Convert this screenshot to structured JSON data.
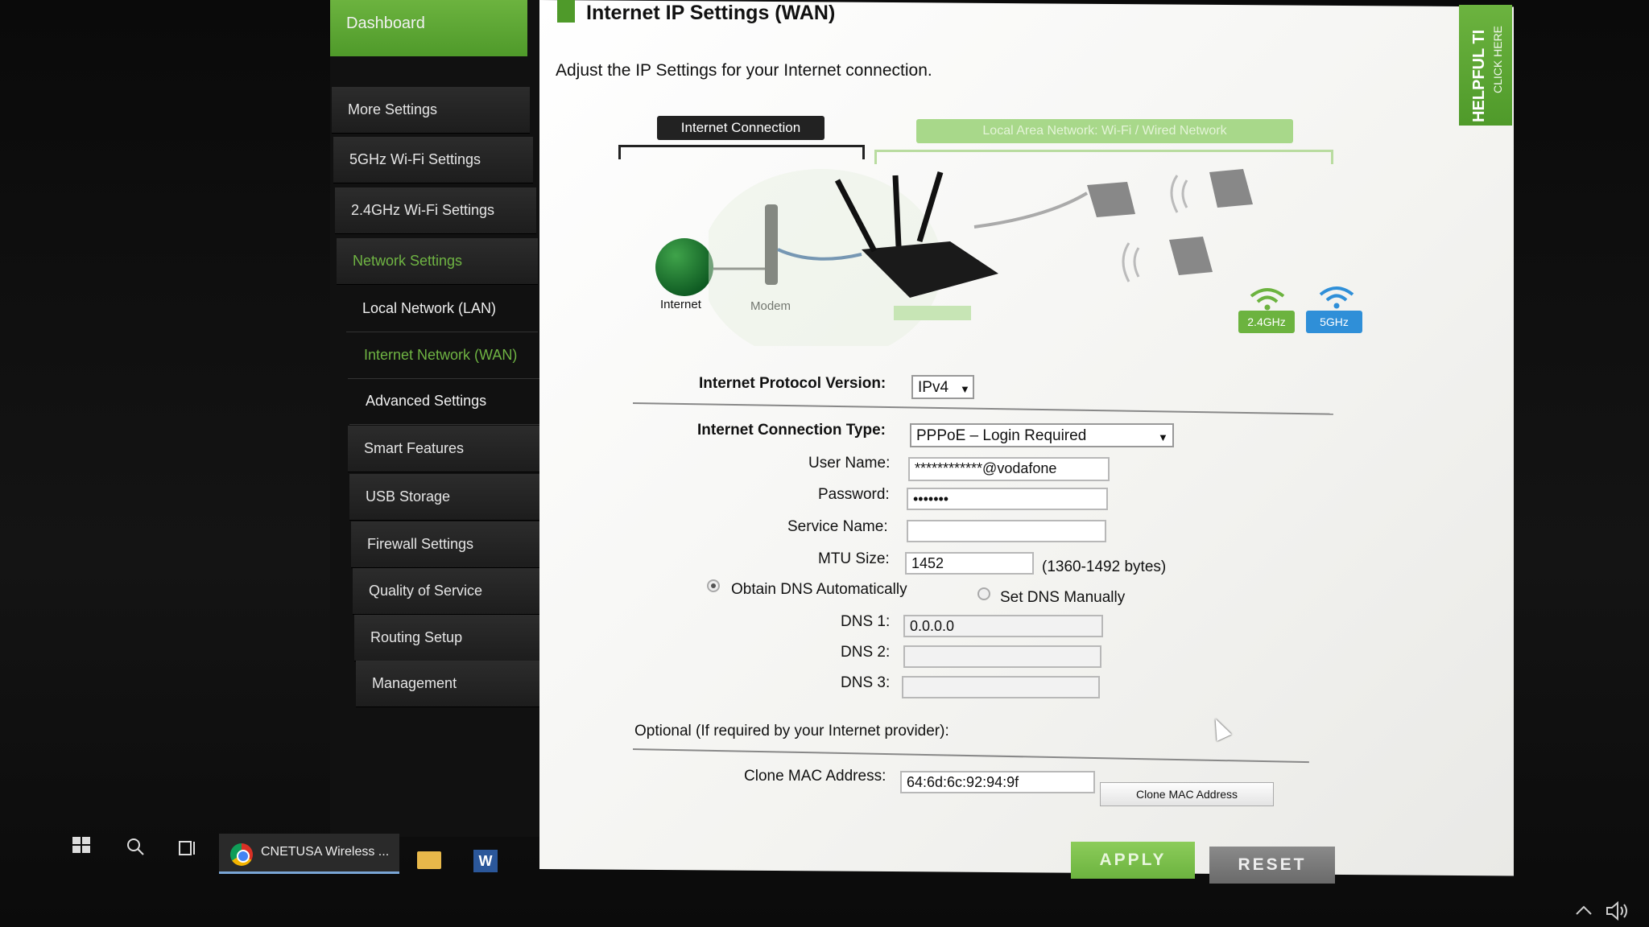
{
  "sidebar": {
    "dashboard": "Dashboard",
    "items": [
      {
        "label": "More Settings"
      },
      {
        "label": "5GHz Wi-Fi Settings"
      },
      {
        "label": "2.4GHz Wi-Fi Settings"
      },
      {
        "label": "Network Settings",
        "active": true
      },
      {
        "label": "Local Network (LAN)",
        "sub": true
      },
      {
        "label": "Internet Network (WAN)",
        "sub": true,
        "active": true
      },
      {
        "label": "Advanced Settings",
        "sub": true
      },
      {
        "label": "Smart Features"
      },
      {
        "label": "USB Storage"
      },
      {
        "label": "Firewall Settings"
      },
      {
        "label": "Quality of Service"
      },
      {
        "label": "Routing Setup"
      },
      {
        "label": "Management"
      }
    ]
  },
  "header": {
    "title": "Internet IP Settings (WAN)",
    "description": "Adjust the IP Settings for your Internet connection."
  },
  "helpful_tab": {
    "title": "HELPFUL TI",
    "subtitle": "CLICK HERE"
  },
  "diagram": {
    "internet_connection": "Internet Connection",
    "local_network": "Local Area Network: Wi-Fi / Wired Network",
    "internet_label": "Internet",
    "modem_label": "Modem",
    "band_24": "2.4GHz",
    "band_5": "5GHz"
  },
  "form": {
    "protocol_label": "Internet Protocol Version:",
    "protocol_value": "IPv4",
    "conn_type_label": "Internet Connection Type:",
    "conn_type_value": "PPPoE – Login Required",
    "username_label": "User Name:",
    "username_value": "************@vodafone",
    "password_label": "Password:",
    "password_value": "•••••••",
    "service_label": "Service Name:",
    "service_value": "",
    "mtu_label": "MTU Size:",
    "mtu_value": "1452",
    "mtu_hint": "(1360-1492 bytes)",
    "dns_auto": "Obtain DNS Automatically",
    "dns_manual": "Set DNS Manually",
    "dns1_label": "DNS 1:",
    "dns1_value": "0.0.0.0",
    "dns2_label": "DNS 2:",
    "dns2_value": "",
    "dns3_label": "DNS 3:",
    "dns3_value": "",
    "optional_text": "Optional (If required by your Internet provider):",
    "clone_label": "Clone MAC Address:",
    "clone_value": "64:6d:6c:92:94:9f",
    "clone_button": "Clone MAC Address",
    "apply": "APPLY",
    "reset": "RESET"
  },
  "taskbar": {
    "app_label": "CNETUSA Wireless ...",
    "word_letter": "W"
  },
  "colors": {
    "accent": "#6cb33f",
    "band_24": "#6cb33f",
    "band_5": "#2f8fd8"
  }
}
